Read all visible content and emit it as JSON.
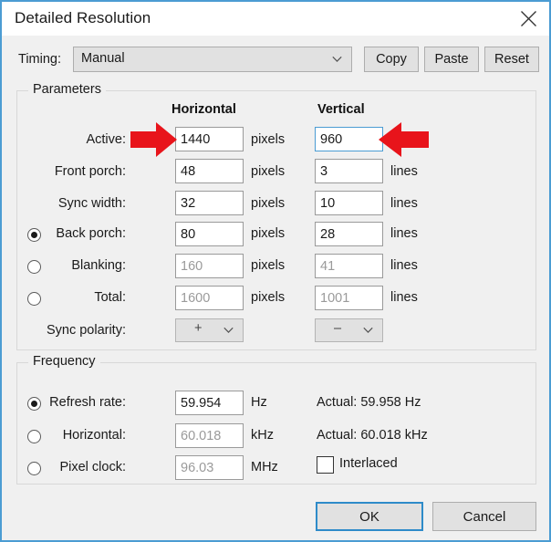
{
  "window": {
    "title": "Detailed Resolution",
    "close_icon": "close-icon"
  },
  "timing": {
    "label": "Timing:",
    "value": "Manual",
    "buttons": {
      "copy": "Copy",
      "paste": "Paste",
      "reset": "Reset"
    }
  },
  "parameters": {
    "group_title": "Parameters",
    "columns": {
      "horizontal": "Horizontal",
      "vertical": "Vertical"
    },
    "rows": [
      {
        "label": "Active:",
        "h_value": "1440",
        "h_unit": "pixels",
        "h_disabled": false,
        "h_focused": false,
        "v_value": "960",
        "v_unit": "pixels",
        "v_disabled": false,
        "v_focused": true,
        "radio": false
      },
      {
        "label": "Front porch:",
        "h_value": "48",
        "h_unit": "pixels",
        "h_disabled": false,
        "h_focused": false,
        "v_value": "3",
        "v_unit": "lines",
        "v_disabled": false,
        "v_focused": false,
        "radio": false
      },
      {
        "label": "Sync width:",
        "h_value": "32",
        "h_unit": "pixels",
        "h_disabled": false,
        "h_focused": false,
        "v_value": "10",
        "v_unit": "lines",
        "v_disabled": false,
        "v_focused": false,
        "radio": false
      },
      {
        "label": "Back porch:",
        "h_value": "80",
        "h_unit": "pixels",
        "h_disabled": false,
        "h_focused": false,
        "v_value": "28",
        "v_unit": "lines",
        "v_disabled": false,
        "v_focused": false,
        "radio": true,
        "radio_checked": true
      },
      {
        "label": "Blanking:",
        "h_value": "160",
        "h_unit": "pixels",
        "h_disabled": true,
        "h_focused": false,
        "v_value": "41",
        "v_unit": "lines",
        "v_disabled": true,
        "v_focused": false,
        "radio": true,
        "radio_checked": false
      },
      {
        "label": "Total:",
        "h_value": "1600",
        "h_unit": "pixels",
        "h_disabled": true,
        "h_focused": false,
        "v_value": "1001",
        "v_unit": "lines",
        "v_disabled": true,
        "v_focused": false,
        "radio": true,
        "radio_checked": false
      }
    ],
    "sync_polarity": {
      "label": "Sync polarity:",
      "horizontal": "+",
      "vertical": "–"
    }
  },
  "frequency": {
    "group_title": "Frequency",
    "rows": [
      {
        "label": "Refresh rate:",
        "value": "59.954",
        "unit": "Hz",
        "disabled": false,
        "radio_checked": true,
        "actual": "Actual: 59.958 Hz"
      },
      {
        "label": "Horizontal:",
        "value": "60.018",
        "unit": "kHz",
        "disabled": true,
        "radio_checked": false,
        "actual": "Actual: 60.018 kHz"
      },
      {
        "label": "Pixel clock:",
        "value": "96.03",
        "unit": "MHz",
        "disabled": true,
        "radio_checked": false,
        "actual": ""
      }
    ],
    "interlaced_label": "Interlaced",
    "interlaced_checked": false
  },
  "footer": {
    "ok": "OK",
    "cancel": "Cancel"
  },
  "annotations": {
    "arrow_color": "#e8141b",
    "left_arrow": "arrow-right-pointing",
    "right_arrow": "arrow-left-pointing"
  }
}
